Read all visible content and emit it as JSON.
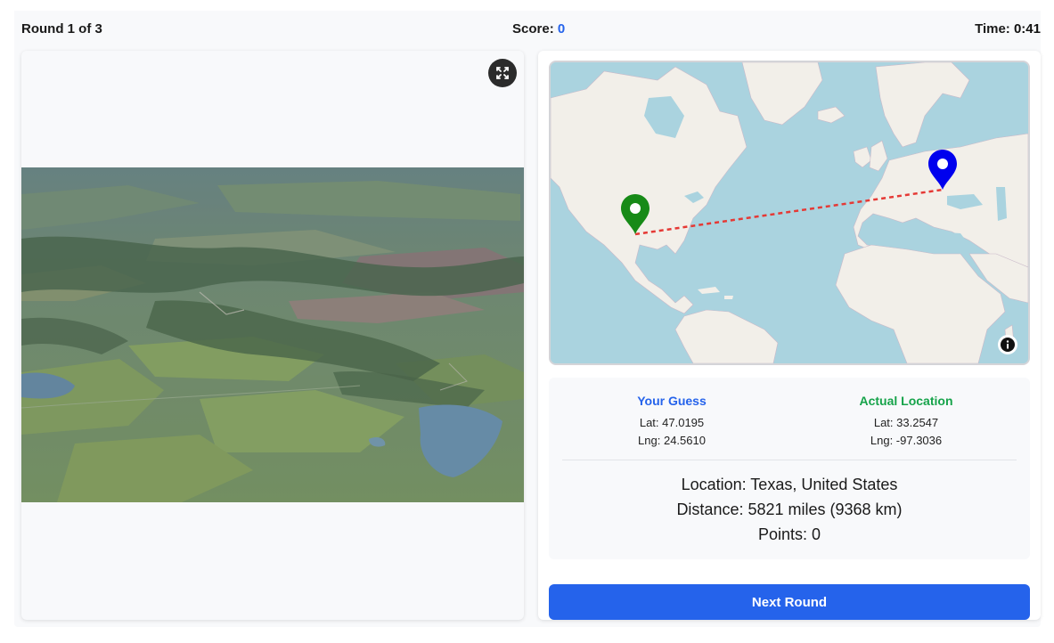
{
  "header": {
    "round_text": "Round 1 of 3",
    "score_label": "Score:",
    "score_value": "0",
    "time_label": "Time:",
    "time_value": "0:41"
  },
  "photo": {
    "icon": "fullscreen-icon"
  },
  "map": {
    "guess_marker_color": "#1a8a1a",
    "actual_marker_color": "#0000ee",
    "line_color": "#e53935",
    "info_icon": "info-icon"
  },
  "results": {
    "guess": {
      "heading": "Your Guess",
      "lat": "Lat: 47.0195",
      "lng": "Lng: 24.5610"
    },
    "actual": {
      "heading": "Actual Location",
      "lat": "Lat: 33.2547",
      "lng": "Lng: -97.3036"
    },
    "location": "Location: Texas, United States",
    "distance": "Distance: 5821 miles (9368 km)",
    "points": "Points: 0"
  },
  "next_button_label": "Next Round",
  "colors": {
    "accent": "#2563eb",
    "guess": "#2563eb",
    "actual": "#16a34a"
  }
}
